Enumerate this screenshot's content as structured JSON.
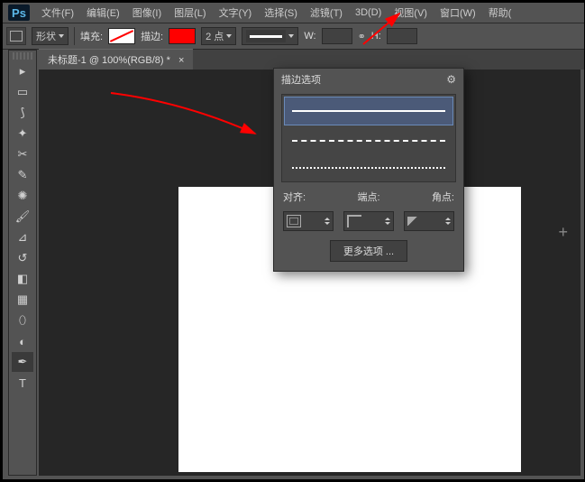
{
  "app": {
    "logo": "Ps"
  },
  "menu": {
    "file": "文件(F)",
    "edit": "编辑(E)",
    "image": "图像(I)",
    "layer": "图层(L)",
    "type": "文字(Y)",
    "select": "选择(S)",
    "filter": "滤镜(T)",
    "threeD": "3D(D)",
    "view": "视图(V)",
    "window": "窗口(W)",
    "help": "帮助("
  },
  "optbar": {
    "shape": "形状",
    "fill": "填充:",
    "stroke": "描边:",
    "width": "2 点",
    "w": "W:",
    "h": "H:"
  },
  "tab": {
    "title": "未标题-1 @ 100%(RGB/8) *"
  },
  "popup": {
    "title": "描边选项",
    "align": "对齐:",
    "caps": "端点:",
    "corners": "角点:",
    "more": "更多选项 ..."
  }
}
